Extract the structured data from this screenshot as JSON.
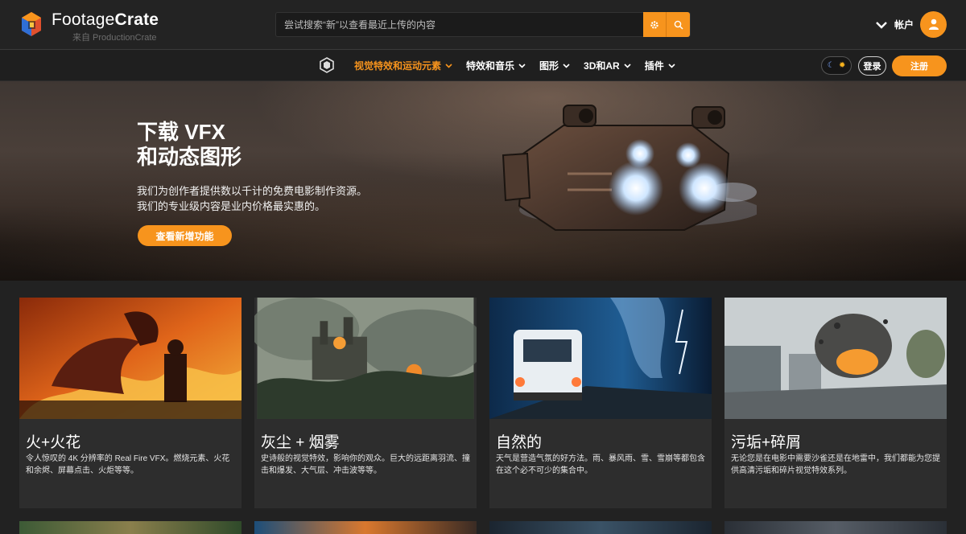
{
  "header": {
    "logo_name_light": "Footage",
    "logo_name_bold": "Crate",
    "logo_sub": "来自 ProductionCrate",
    "search_placeholder": "尝试搜索“新”以查看最近上传的内容",
    "account_label": "帐户"
  },
  "nav": {
    "items": [
      {
        "label": "视觉特效和运动元素",
        "active": true
      },
      {
        "label": "特效和音乐"
      },
      {
        "label": "图形"
      },
      {
        "label": "3D和AR"
      },
      {
        "label": "插件"
      }
    ],
    "login": "登录",
    "signup": "注册"
  },
  "hero": {
    "title_line1": "下载 VFX",
    "title_line2": "和动态图形",
    "desc_line1": "我们为创作者提供数以千计的免费电影制作资源。",
    "desc_line2": "我们的专业级内容是业内价格最实惠的。",
    "cta": "查看新增功能"
  },
  "cards": [
    {
      "title": "火+火花",
      "desc": "令人惊叹的 4K 分辨率的 Real Fire VFX。燃烧元素、火花和余烬、屏幕点击、火炬等等。"
    },
    {
      "title": "灰尘 + 烟雾",
      "desc": "史诗般的视觉特效，影响你的观众。巨大的远距离羽流、撞击和爆发、大气层、冲击波等等。"
    },
    {
      "title": "自然的",
      "desc": "天气是营造气氛的好方法。雨、暴风雨、雪、雪崩等都包含在这个必不可少的集合中。"
    },
    {
      "title": "污垢+碎屑",
      "desc": "无论您是在电影中需要沙雀还是在地雷中，我们都能为您提供高清污垢和碎片视觉特效系列。"
    }
  ],
  "colors": {
    "accent": "#f7941d",
    "header_bg": "#232323",
    "card_bg": "#2d2d2d"
  }
}
